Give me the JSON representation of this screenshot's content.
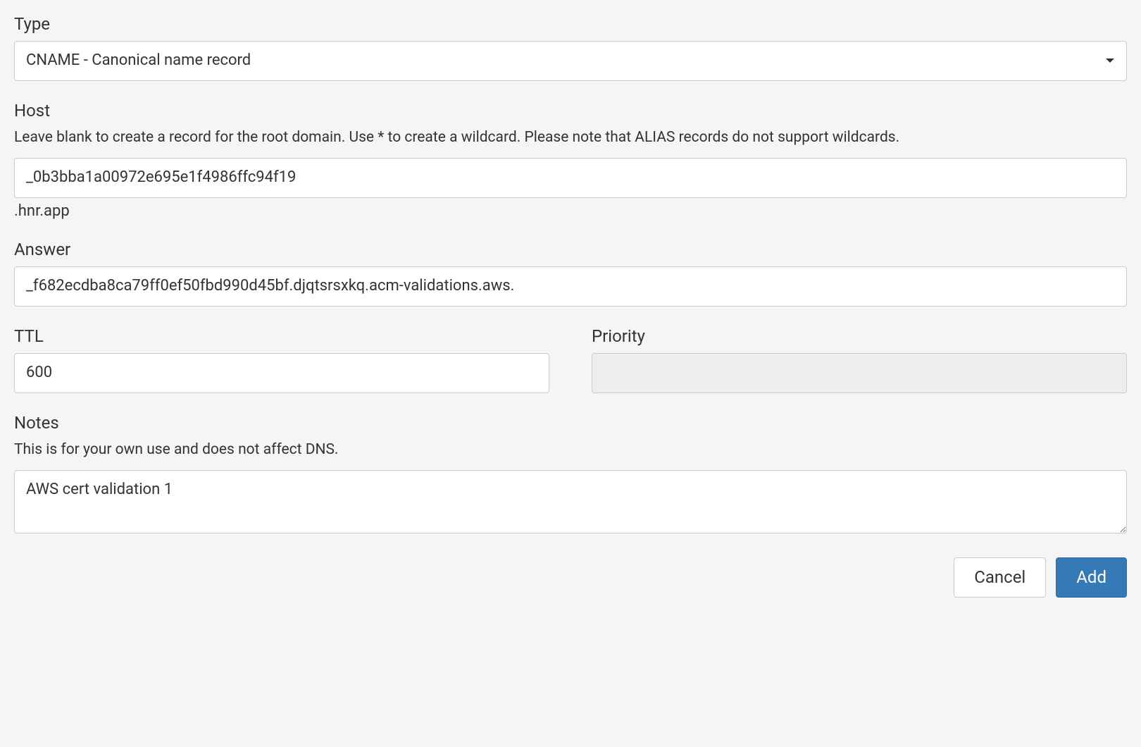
{
  "type": {
    "label": "Type",
    "value": "CNAME - Canonical name record"
  },
  "host": {
    "label": "Host",
    "hint": "Leave blank to create a record for the root domain. Use * to create a wildcard. Please note that ALIAS records do not support wildcards.",
    "value": "_0b3bba1a00972e695e1f4986ffc94f19",
    "suffix": ".hnr.app"
  },
  "answer": {
    "label": "Answer",
    "value": "_f682ecdba8ca79ff0ef50fbd990d45bf.djqtsrsxkq.acm-validations.aws."
  },
  "ttl": {
    "label": "TTL",
    "value": "600"
  },
  "priority": {
    "label": "Priority",
    "value": ""
  },
  "notes": {
    "label": "Notes",
    "hint": "This is for your own use and does not affect DNS.",
    "value": "AWS cert validation 1"
  },
  "buttons": {
    "cancel": "Cancel",
    "add": "Add"
  }
}
